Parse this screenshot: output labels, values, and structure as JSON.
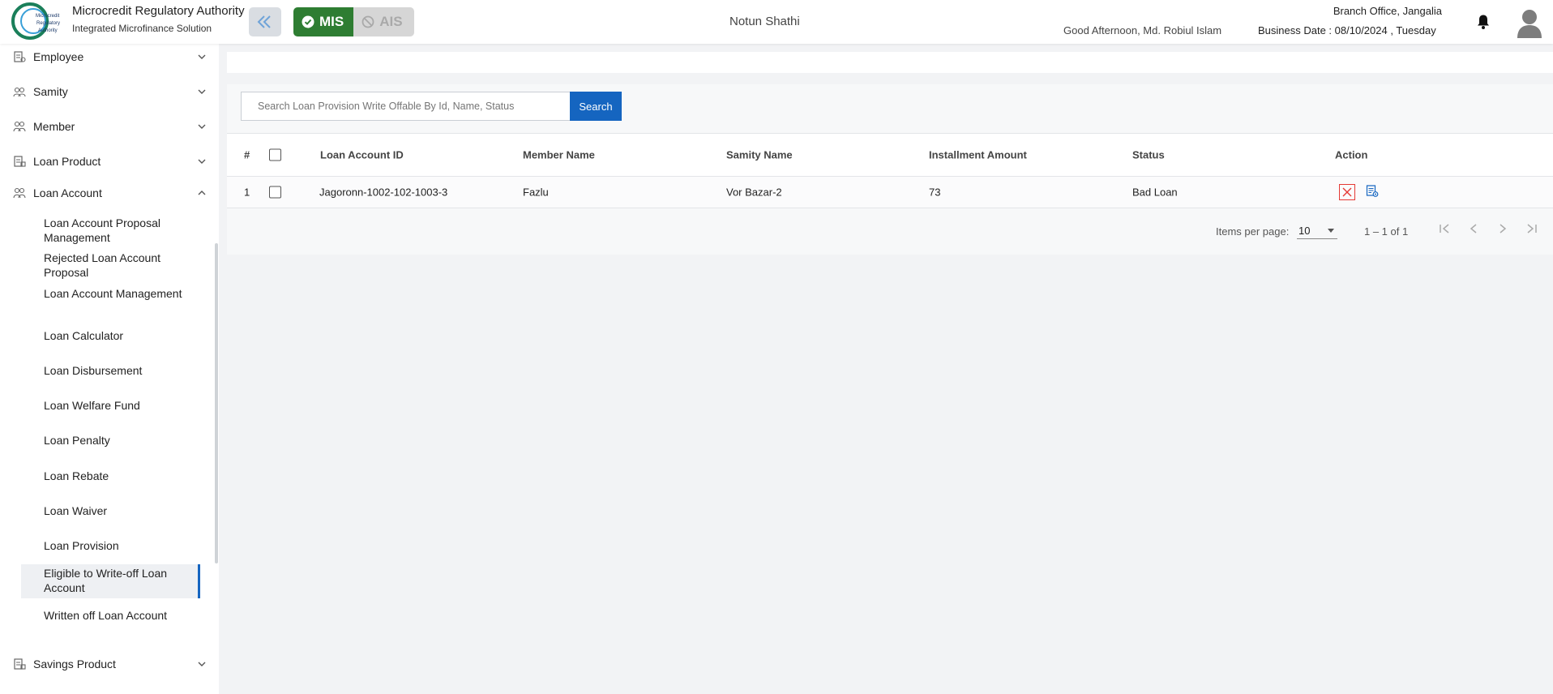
{
  "header": {
    "org_name": "Microcredit Regulatory Authority",
    "org_sub": "Integrated Microfinance Solution",
    "logo_text": "Microcredit Regulatory Authority",
    "mis_label": "MIS",
    "ais_label": "AIS",
    "app_title": "Notun Shathi",
    "greeting": "Good Afternoon, Md. Robiul Islam",
    "branch": "Branch Office, Jangalia",
    "business_date": "Business Date : 08/10/2024 , Tuesday"
  },
  "sidebar": {
    "items": [
      {
        "label": "Employee",
        "icon": "employee-icon",
        "expanded": false
      },
      {
        "label": "Samity",
        "icon": "samity-icon",
        "expanded": false
      },
      {
        "label": "Member",
        "icon": "member-icon",
        "expanded": false
      },
      {
        "label": "Loan Product",
        "icon": "loan-product-icon",
        "expanded": false
      },
      {
        "label": "Loan Account",
        "icon": "loan-account-icon",
        "expanded": true
      },
      {
        "label": "Savings Product",
        "icon": "savings-product-icon",
        "expanded": false
      }
    ],
    "loan_account_sub": [
      "Loan Account Proposal Management",
      "Rejected Loan Account Proposal",
      "Loan Account Management",
      "Loan Calculator",
      "Loan Disbursement",
      "Loan Welfare Fund",
      "Loan Penalty",
      "Loan Rebate",
      "Loan Waiver",
      "Loan Provision",
      "Eligible to Write-off Loan Account",
      "Written off Loan Account"
    ],
    "active_sub": "Eligible to Write-off Loan Account"
  },
  "search": {
    "placeholder": "Search Loan Provision Write Offable By Id, Name, Status",
    "value": "",
    "button_label": "Search"
  },
  "table": {
    "columns": [
      "#",
      "Loan Account ID",
      "Member Name",
      "Samity Name",
      "Installment Amount",
      "Status",
      "Action"
    ],
    "rows": [
      {
        "index": "1",
        "loan_account_id": "Jagoronn-1002-102-1003-3",
        "member_name": "Fazlu",
        "samity_name": "Vor Bazar-2",
        "installment_amount": "73",
        "status": "Bad Loan"
      }
    ]
  },
  "paginator": {
    "items_per_page_label": "Items per page:",
    "items_per_page": "10",
    "range": "1 – 1 of 1"
  },
  "colors": {
    "primary": "#1565c0",
    "mis_green": "#2e7d32",
    "danger": "#e53935"
  }
}
